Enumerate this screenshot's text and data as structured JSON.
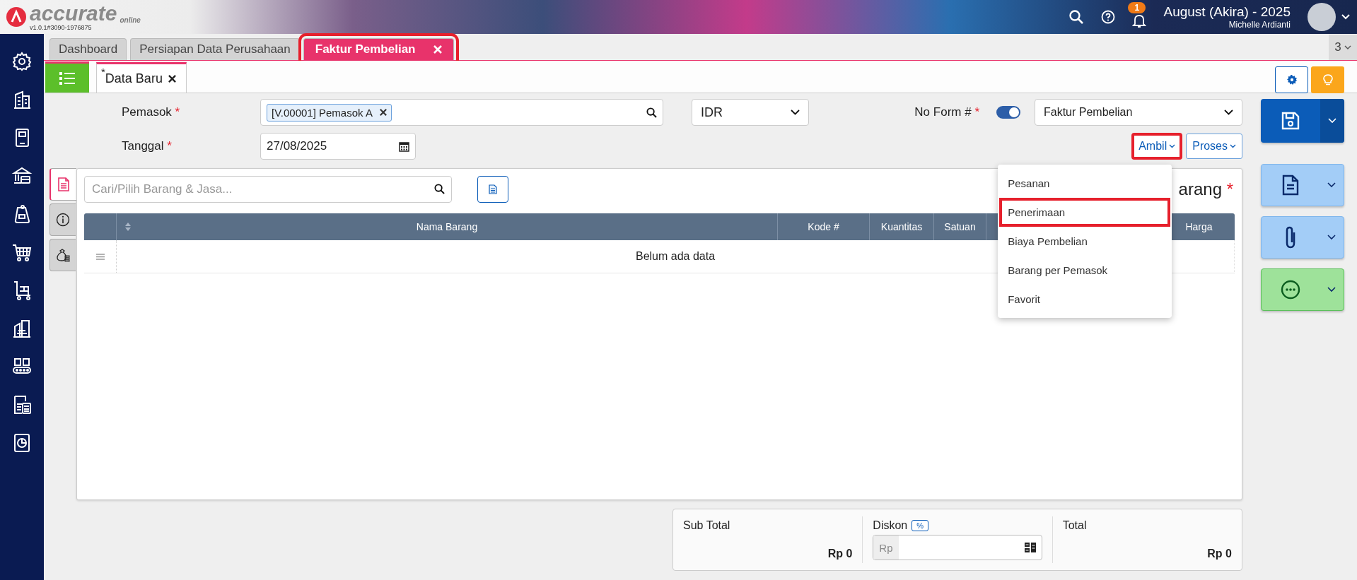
{
  "header": {
    "logo": "accurate",
    "logo_sub": "online",
    "version": "v1.0.1#3090-1976875",
    "notification_count": "1",
    "period": "August (Akira) - 2025",
    "user": "Michelle Ardianti"
  },
  "sidebar": {
    "items": [
      {
        "kind": "gear"
      },
      {
        "kind": "building"
      },
      {
        "kind": "book"
      },
      {
        "kind": "bank"
      },
      {
        "kind": "price-tag"
      },
      {
        "kind": "cart"
      },
      {
        "kind": "trolley"
      },
      {
        "kind": "factory"
      },
      {
        "kind": "conveyor"
      },
      {
        "kind": "tax"
      },
      {
        "kind": "report"
      }
    ]
  },
  "tabs": [
    {
      "label": "Dashboard",
      "selected": false,
      "highlighted": false,
      "closable": false
    },
    {
      "label": "Persiapan Data Perusahaan",
      "selected": false,
      "highlighted": false,
      "closable": false
    },
    {
      "label": "Faktur Pembelian",
      "selected": true,
      "highlighted": true,
      "closable": true
    }
  ],
  "tab_count": "3",
  "subtabs": [
    {
      "label": "Data Baru",
      "modified_mark": "*",
      "selected": true
    }
  ],
  "form": {
    "supplier": {
      "label": "Pemasok",
      "mark": "*",
      "tag": "[V.00001] Pemasok A"
    },
    "currency": "IDR",
    "form_number": {
      "label": "No Form #",
      "mark": "*",
      "toggle_on": true
    },
    "form_type": "Faktur Pembelian",
    "date": {
      "label": "Tanggal",
      "mark": "*",
      "value": "27/08/2025"
    },
    "buttons": [
      {
        "label": "Ambil",
        "highlighted": true
      },
      {
        "label": "Proses",
        "highlighted": false
      }
    ]
  },
  "menu": {
    "open": true,
    "items": [
      {
        "label": "Pesanan",
        "highlighted": false
      },
      {
        "label": "Penerimaan",
        "highlighted": true
      },
      {
        "label": "Biaya Pembelian",
        "highlighted": false
      },
      {
        "label": "Barang per Pemasok",
        "highlighted": false
      },
      {
        "label": "Favorit",
        "highlighted": false
      }
    ]
  },
  "panel": {
    "side_tabs": [
      {
        "kind": "document",
        "selected": true
      },
      {
        "kind": "info",
        "selected": false
      },
      {
        "kind": "money-bag",
        "selected": false
      }
    ],
    "search": {
      "placeholder": "Cari/Pilih Barang & Jasa..."
    },
    "title": "arang",
    "title_mark": "*",
    "table": {
      "columns": [
        "",
        "Nama Barang",
        "Kode #",
        "Kuantitas",
        "Satuan",
        "",
        "Harga"
      ],
      "empty_message": "Belum ada data"
    }
  },
  "totals": {
    "subtotal": {
      "label": "Sub Total",
      "value": "Rp 0"
    },
    "discount": {
      "label": "Diskon",
      "badge": "%",
      "prefix": "Rp"
    },
    "total": {
      "label": "Total",
      "value": "Rp 0"
    }
  },
  "actions": [
    {
      "kind": "save",
      "color": "#0b5cb8"
    },
    {
      "kind": "document",
      "color": "#a3cdf7"
    },
    {
      "kind": "attachment",
      "color": "#a3cdf7"
    },
    {
      "kind": "more",
      "color": "#9ee29a"
    }
  ]
}
